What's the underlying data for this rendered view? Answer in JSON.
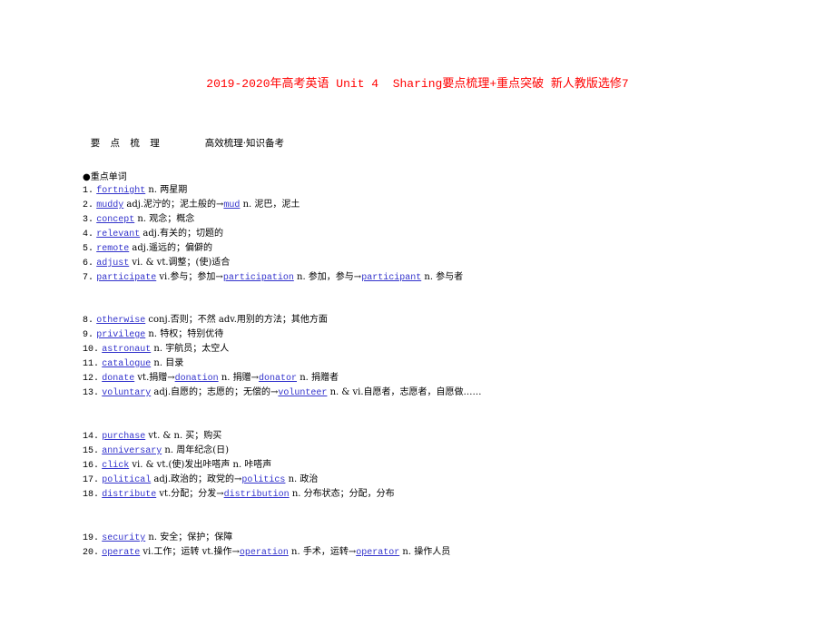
{
  "document": {
    "title": "2019-2020年高考英语 Unit 4  Sharing要点梳理+重点突破 新人教版选修7",
    "title_color": "#ff0000",
    "link_color": "#3333cc",
    "section_header": {
      "left": "要 点 梳 理",
      "right": "高效梳理·知识备考"
    },
    "subsection_title": "●重点单词",
    "groups": [
      {
        "items": [
          {
            "num": "1.",
            "parts": [
              {
                "t": "link",
                "v": "fortnight"
              },
              {
                "t": "text",
                "v": " n. 两星期"
              }
            ]
          },
          {
            "num": "2.",
            "parts": [
              {
                "t": "link",
                "v": "muddy"
              },
              {
                "t": "text",
                "v": " adj.泥泞的；泥土般的→"
              },
              {
                "t": "link",
                "v": "mud"
              },
              {
                "t": "text",
                "v": " n. 泥巴，泥土"
              }
            ]
          },
          {
            "num": "3.",
            "parts": [
              {
                "t": "link",
                "v": "concept"
              },
              {
                "t": "text",
                "v": " n. 观念；概念"
              }
            ]
          },
          {
            "num": "4.",
            "parts": [
              {
                "t": "link",
                "v": "relevant"
              },
              {
                "t": "text",
                "v": " adj.有关的；切题的"
              }
            ]
          },
          {
            "num": "5.",
            "parts": [
              {
                "t": "link",
                "v": "remote"
              },
              {
                "t": "text",
                "v": " adj.遥远的；偏僻的"
              }
            ]
          },
          {
            "num": "6.",
            "parts": [
              {
                "t": "link",
                "v": "adjust"
              },
              {
                "t": "text",
                "v": " vi. & vt.调整；(使)适合"
              }
            ]
          },
          {
            "num": "7.",
            "parts": [
              {
                "t": "link",
                "v": "participate"
              },
              {
                "t": "text",
                "v": " vi.参与；参加→"
              },
              {
                "t": "link",
                "v": "participation"
              },
              {
                "t": "text",
                "v": " n. 参加，参与→"
              },
              {
                "t": "link",
                "v": "participant"
              },
              {
                "t": "text",
                "v": " n. 参与者"
              }
            ]
          }
        ]
      },
      {
        "items": [
          {
            "num": "8.",
            "parts": [
              {
                "t": "link",
                "v": "otherwise"
              },
              {
                "t": "text",
                "v": " conj.否则；不然 adv.用别的方法；其他方面"
              }
            ]
          },
          {
            "num": "9.",
            "parts": [
              {
                "t": "link",
                "v": "privilege"
              },
              {
                "t": "text",
                "v": " n. 特权；特别优待"
              }
            ]
          },
          {
            "num": "10.",
            "parts": [
              {
                "t": "link",
                "v": "astronaut"
              },
              {
                "t": "text",
                "v": " n. 宇航员；太空人"
              }
            ]
          },
          {
            "num": "11.",
            "parts": [
              {
                "t": "link",
                "v": "catalogue"
              },
              {
                "t": "text",
                "v": " n. 目录"
              }
            ]
          },
          {
            "num": "12.",
            "parts": [
              {
                "t": "link",
                "v": "donate"
              },
              {
                "t": "text",
                "v": " vt.捐赠→"
              },
              {
                "t": "link",
                "v": "donation"
              },
              {
                "t": "text",
                "v": " n. 捐赠→"
              },
              {
                "t": "link",
                "v": "donator"
              },
              {
                "t": "text",
                "v": " n. 捐赠者"
              }
            ]
          },
          {
            "num": "13.",
            "parts": [
              {
                "t": "link",
                "v": "voluntary"
              },
              {
                "t": "text",
                "v": " adj.自愿的；志愿的；无偿的→"
              },
              {
                "t": "link",
                "v": "volunteer"
              },
              {
                "t": "text",
                "v": " n. & vi.自愿者，志愿者，自愿做……"
              }
            ]
          }
        ]
      },
      {
        "items": [
          {
            "num": "14.",
            "parts": [
              {
                "t": "link",
                "v": "purchase"
              },
              {
                "t": "text",
                "v": " vt. & n. 买；购买"
              }
            ]
          },
          {
            "num": "15.",
            "parts": [
              {
                "t": "link",
                "v": "anniversary"
              },
              {
                "t": "text",
                "v": " n. 周年纪念(日)"
              }
            ]
          },
          {
            "num": "16.",
            "parts": [
              {
                "t": "link",
                "v": "click"
              },
              {
                "t": "text",
                "v": " vi. & vt.(使)发出咔嗒声 n. 咔嗒声"
              }
            ]
          },
          {
            "num": "17.",
            "parts": [
              {
                "t": "link",
                "v": "political"
              },
              {
                "t": "text",
                "v": " adj.政治的；政党的→"
              },
              {
                "t": "link",
                "v": "politics"
              },
              {
                "t": "text",
                "v": " n. 政治"
              }
            ]
          },
          {
            "num": "18.",
            "parts": [
              {
                "t": "link",
                "v": "distribute"
              },
              {
                "t": "text",
                "v": " vt.分配；分发→"
              },
              {
                "t": "link",
                "v": "distribution"
              },
              {
                "t": "text",
                "v": " n. 分布状态；分配，分布"
              }
            ]
          }
        ]
      },
      {
        "items": [
          {
            "num": "19.",
            "parts": [
              {
                "t": "link",
                "v": "security"
              },
              {
                "t": "text",
                "v": " n. 安全；保护；保障"
              }
            ]
          },
          {
            "num": "20.",
            "parts": [
              {
                "t": "link",
                "v": "operate"
              },
              {
                "t": "text",
                "v": " vi.工作；运转 vt.操作→"
              },
              {
                "t": "link",
                "v": "operation"
              },
              {
                "t": "text",
                "v": " n. 手术，运转→"
              },
              {
                "t": "link",
                "v": "operator"
              },
              {
                "t": "text",
                "v": " n. 操作人员"
              }
            ]
          }
        ]
      }
    ]
  }
}
